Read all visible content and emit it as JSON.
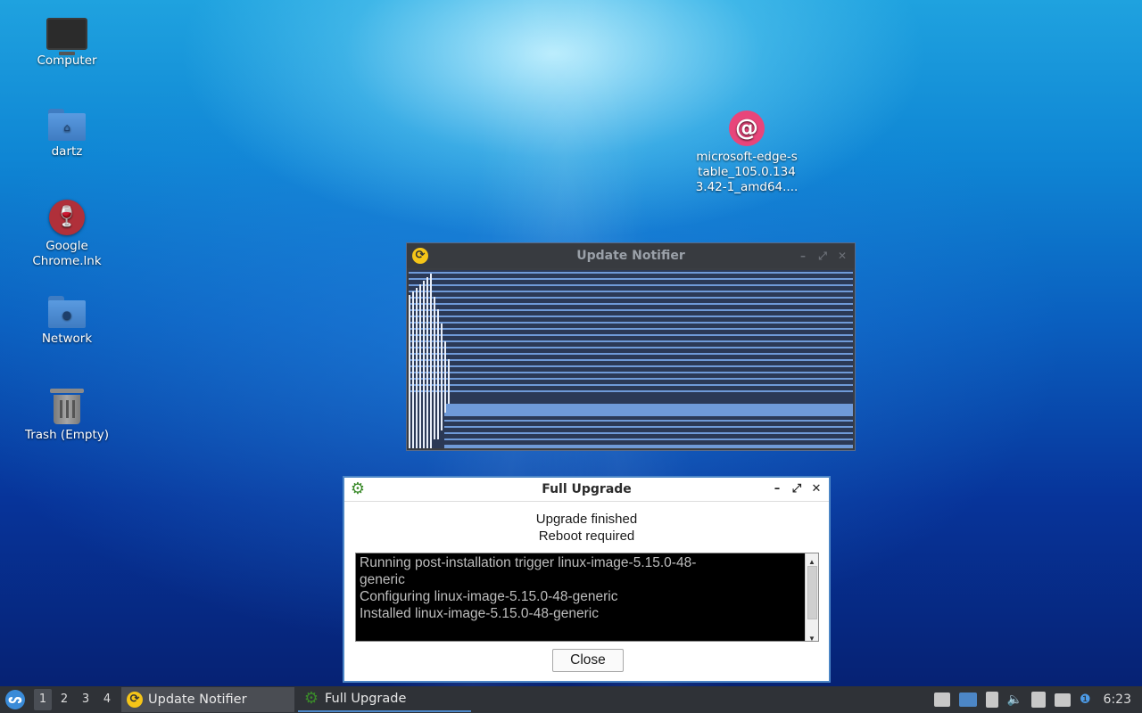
{
  "desktop": {
    "icons": [
      {
        "label": "Computer"
      },
      {
        "label": "dartz"
      },
      {
        "label": "Google Chrome.lnk"
      },
      {
        "label": "Network"
      },
      {
        "label": "Trash (Empty)"
      },
      {
        "label": "microsoft-edge-stable_105.0.1343.42-1_amd64...."
      }
    ]
  },
  "update_notifier": {
    "title": "Update Notifier"
  },
  "full_upgrade": {
    "title": "Full Upgrade",
    "status_line1": "Upgrade finished",
    "status_line2": "Reboot required",
    "log_lines": [
      "Running post-installation trigger linux-image-5.15.0-48-",
      "generic",
      "Configuring linux-image-5.15.0-48-generic",
      "Installed linux-image-5.15.0-48-generic"
    ],
    "close_label": "Close"
  },
  "taskbar": {
    "desktops": [
      "1",
      "2",
      "3",
      "4"
    ],
    "active_desktop": "1",
    "tasks": [
      {
        "label": "Update Notifier"
      },
      {
        "label": "Full Upgrade"
      }
    ],
    "clock": "6:23"
  },
  "colors": {
    "accent": "#4c86c6",
    "titlebar_dark": "#3a3d42",
    "taskbar": "#2f3237"
  }
}
